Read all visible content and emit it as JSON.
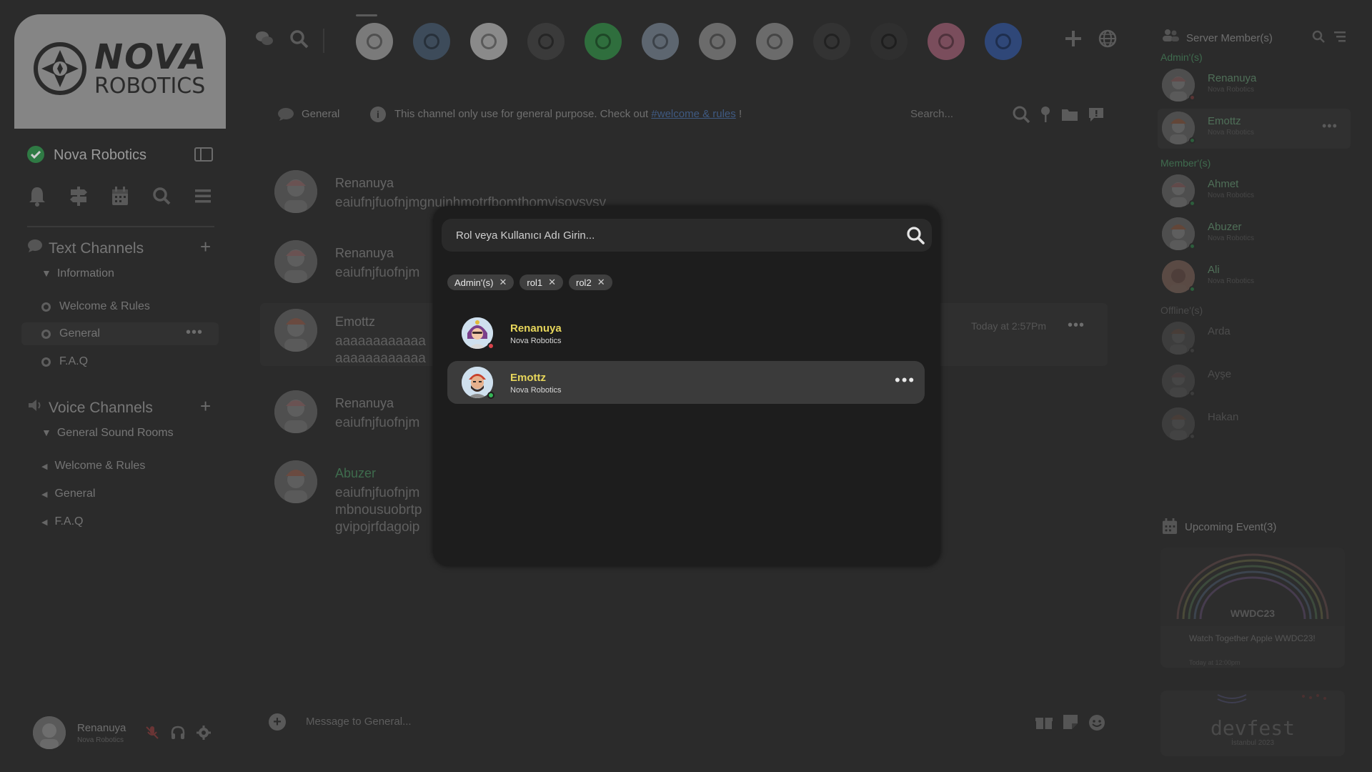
{
  "server": {
    "logo_line1": "NOVA",
    "logo_line2": "ROBOTICS",
    "name": "Nova Robotics"
  },
  "left": {
    "text_channels": {
      "title": "Text Channels",
      "group": "Information",
      "channels": [
        "Welcome & Rules",
        "General",
        "F.A.Q"
      ]
    },
    "voice_channels": {
      "title": "Voice Channels",
      "group": "General Sound Rooms",
      "channels": [
        "Welcome & Rules",
        "General",
        "F.A.Q"
      ]
    },
    "user": {
      "name": "Renanuya",
      "sub": "Nova Robotics"
    }
  },
  "apps": [
    {
      "icon": "app-home-icon",
      "color": "#7a7a7a"
    },
    {
      "icon": "league-icon",
      "color": "#3d4b5a"
    },
    {
      "icon": "openai-icon",
      "color": "#8a8a8a"
    },
    {
      "icon": "apple-icon",
      "color": "#3a3a3a"
    },
    {
      "icon": "spotify-icon",
      "color": "#2f6e3d"
    },
    {
      "icon": "meta-icon",
      "color": "#5d6670"
    },
    {
      "icon": "google-icon",
      "color": "#6b6b6b"
    },
    {
      "icon": "lacoste-icon",
      "color": "#6b6b6b"
    },
    {
      "icon": "mask-icon",
      "color": "#333333"
    },
    {
      "icon": "netflix-icon",
      "color": "#2f2f2f"
    },
    {
      "icon": "dribbble-icon",
      "color": "#7a4d5c"
    },
    {
      "icon": "samsung-icon",
      "color": "#2f4778"
    }
  ],
  "channel_header": {
    "name": "General",
    "desc_prefix": "This channel only use for general purpose. Check out ",
    "desc_link": "#welcome & rules",
    "desc_suffix": " !",
    "search_placeholder": "Search..."
  },
  "messages": [
    {
      "author": "Renanuya",
      "text": "eaiufnjfuofnjmgnuinhmotrfbomthomvisovsvsv",
      "green": false
    },
    {
      "author": "Renanuya",
      "text": "eaiufnjfuofnjm",
      "green": false
    },
    {
      "author": "Emottz",
      "text": "aaaaaaaaaaaa",
      "text2": "aaaaaaaaaaaa",
      "time": "Today at 2:57Pm",
      "green": false
    },
    {
      "author": "Renanuya",
      "text": "eaiufnjfuofnjm",
      "green": false
    },
    {
      "author": "Abuzer",
      "text": "eaiufnjfuofnjm",
      "text2": "mbnousuobrtp",
      "text3": "gvipojrfdagoip",
      "green": true
    }
  ],
  "composer": {
    "placeholder": "Message to General..."
  },
  "members": {
    "title": "Server Member(s)",
    "admins_label": "Admin'(s)",
    "admins": [
      {
        "name": "Renanuya",
        "sub": "Nova Robotics"
      },
      {
        "name": "Emottz",
        "sub": "Nova Robotics"
      }
    ],
    "members_label": "Member'(s)",
    "members": [
      {
        "name": "Ahmet",
        "sub": "Nova Robotics"
      },
      {
        "name": "Abuzer",
        "sub": "Nova Robotics"
      },
      {
        "name": "Ali",
        "sub": "Nova Robotics"
      }
    ],
    "offline_label": "Offline'(s)",
    "offline": [
      {
        "name": "Arda"
      },
      {
        "name": "Ayşe"
      },
      {
        "name": "Hakan"
      }
    ]
  },
  "events": {
    "title": "Upcoming Event(3)",
    "card1": {
      "badge": "WWDC23",
      "title": "Watch Together Apple WWDC23!",
      "time": "Today at 12:00pm"
    },
    "card2": {
      "title": "devfest",
      "sub": "İstanbul 2023"
    }
  },
  "modal": {
    "search_placeholder": "Rol veya Kullanıcı Adı Girin...",
    "chips": [
      "Admin'(s)",
      "rol1",
      "rol2"
    ],
    "results": [
      {
        "name": "Renanuya",
        "sub": "Nova Robotics",
        "status_color": "#d9434a",
        "selected": false
      },
      {
        "name": "Emottz",
        "sub": "Nova Robotics",
        "status_color": "#35b556",
        "selected": true
      }
    ]
  }
}
